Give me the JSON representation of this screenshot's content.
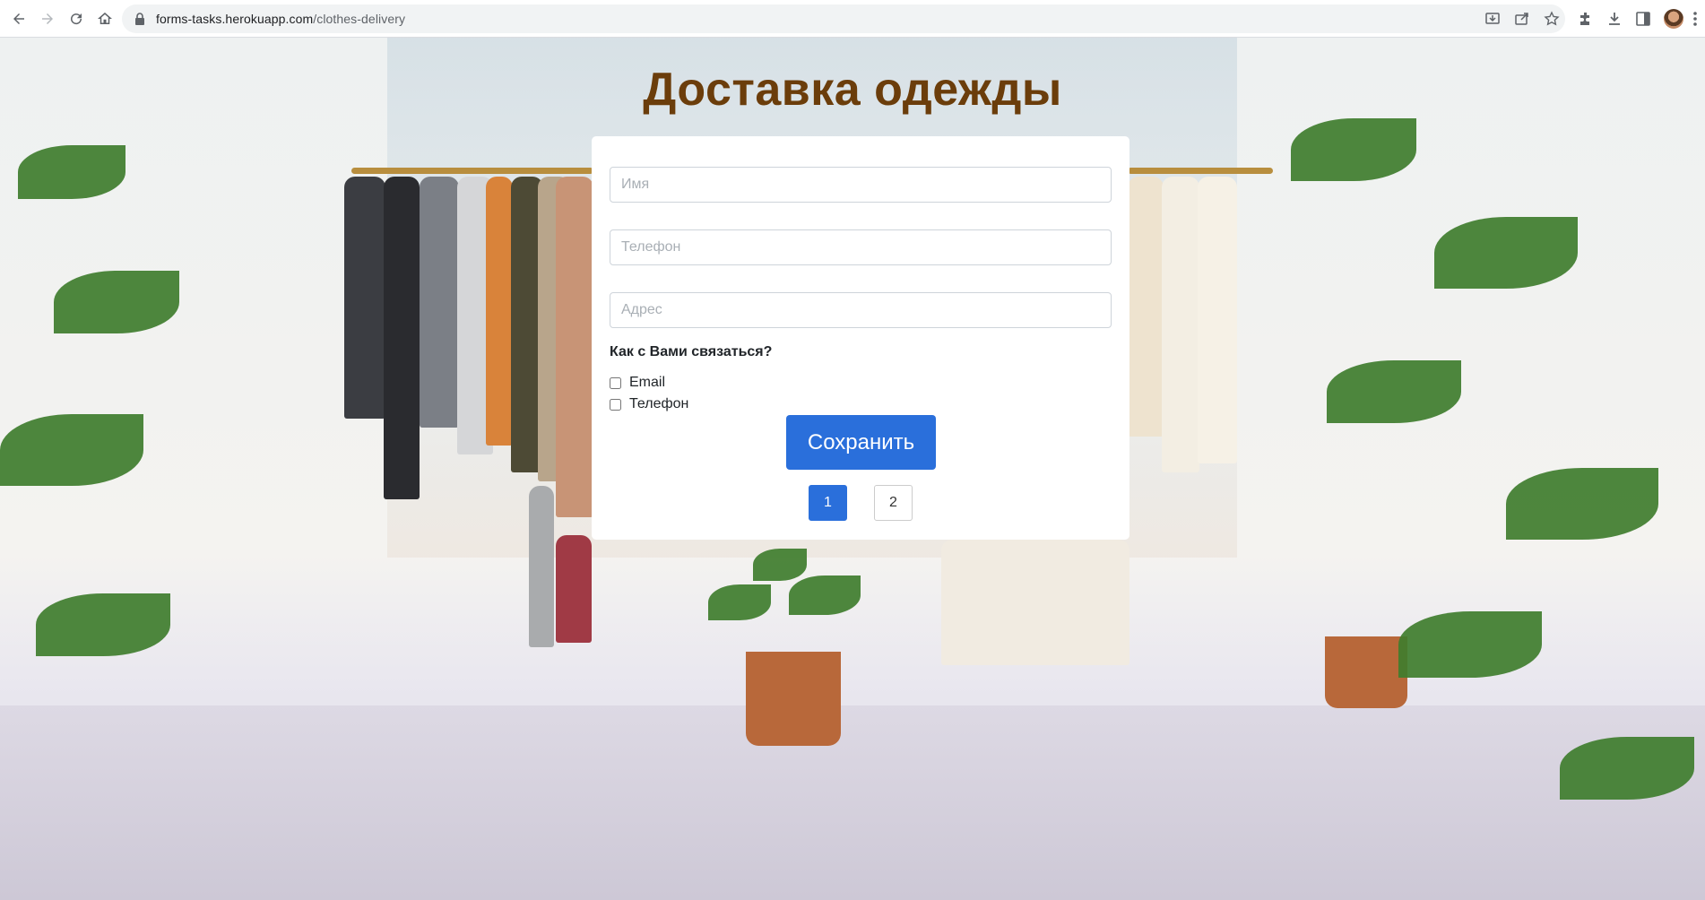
{
  "browser": {
    "url_host": "forms-tasks.herokuapp.com",
    "url_path": "/clothes-delivery"
  },
  "page": {
    "title": "Доставка одежды",
    "form": {
      "name_placeholder": "Имя",
      "phone_placeholder": "Телефон",
      "address_placeholder": "Адрес",
      "contact_question": "Как с Вами связаться?",
      "options": [
        {
          "label": "Email",
          "checked": false
        },
        {
          "label": "Телефон",
          "checked": false
        }
      ],
      "save_label": "Сохранить"
    },
    "pagination": {
      "pages": [
        "1",
        "2"
      ],
      "current": "1"
    }
  },
  "colors": {
    "title": "#6b3d0b",
    "primary": "#2a6fdb"
  }
}
